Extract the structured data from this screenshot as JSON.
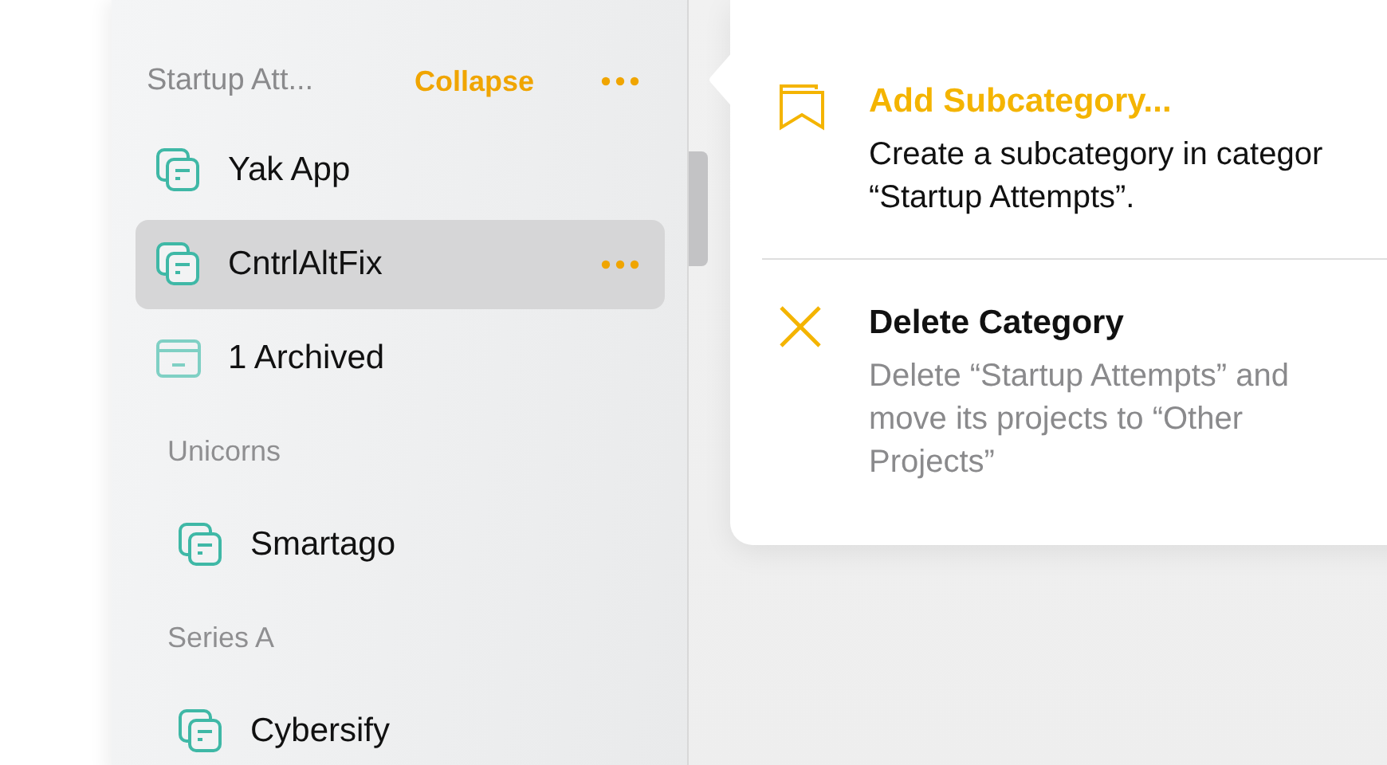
{
  "sidebar": {
    "header": {
      "title": "Startup Att...",
      "action": "Collapse"
    },
    "items": [
      {
        "kind": "project",
        "label": "Yak App",
        "selected": false
      },
      {
        "kind": "project",
        "label": "CntrlAltFix",
        "selected": true
      },
      {
        "kind": "archive",
        "label": "1 Archived",
        "selected": false
      }
    ],
    "groups": [
      {
        "title": "Unicorns",
        "items": [
          {
            "kind": "project",
            "label": "Smartago",
            "selected": false
          }
        ]
      },
      {
        "title": "Series A",
        "items": [
          {
            "kind": "project",
            "label": "Cybersify",
            "selected": false
          }
        ]
      }
    ]
  },
  "popover": {
    "actions": [
      {
        "kind": "add",
        "title": "Add Subcategory...",
        "lines": [
          "Create a subcategory in categor",
          "“Startup Attempts”."
        ]
      },
      {
        "kind": "delete",
        "title": "Delete Category",
        "lines": [
          "Delete “Startup Attempts” and",
          "move its projects to “Other",
          "Projects”"
        ]
      }
    ]
  }
}
